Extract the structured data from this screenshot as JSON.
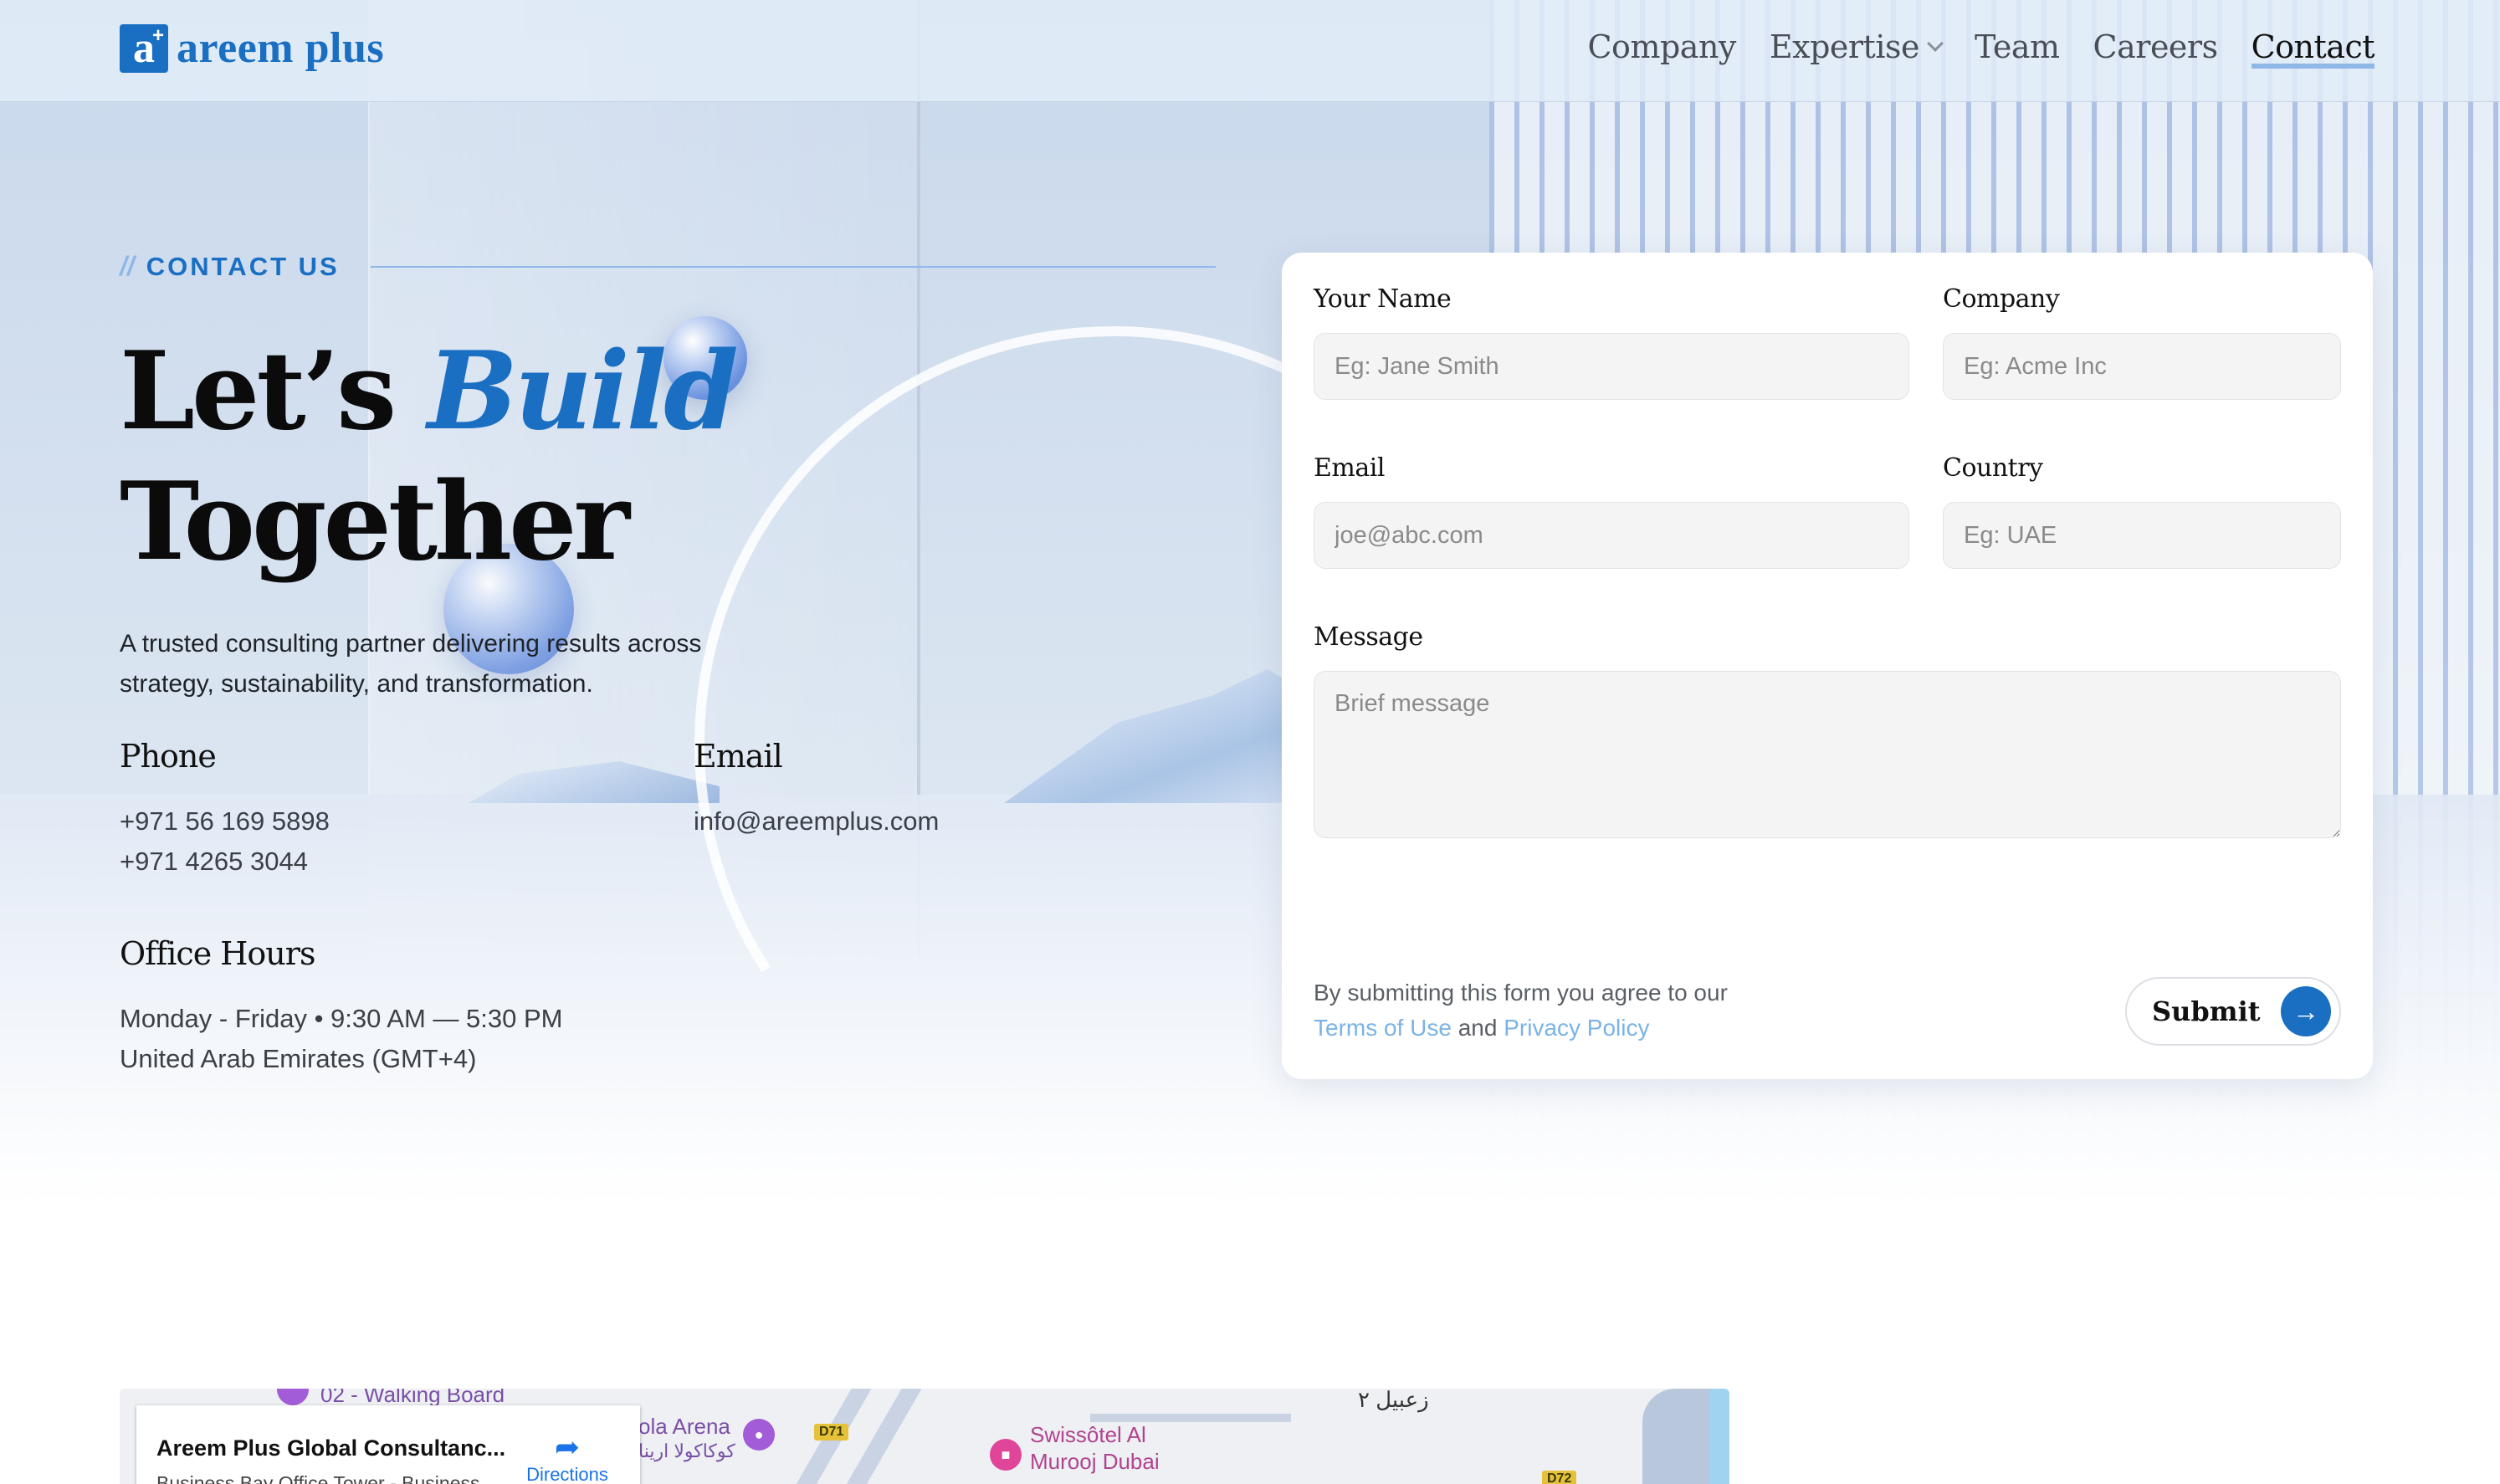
{
  "brand": {
    "mark": "a",
    "mark_plus": "+",
    "name": "areem plus"
  },
  "nav": {
    "items": [
      {
        "label": "Company"
      },
      {
        "label": "Expertise"
      },
      {
        "label": "Team"
      },
      {
        "label": "Careers"
      },
      {
        "label": "Contact"
      }
    ],
    "active": "Contact"
  },
  "hero": {
    "eyebrow_slash": "//",
    "eyebrow": "CONTACT US",
    "headline_part1": "Let’s ",
    "headline_accent": "Build",
    "headline_part2": "Together",
    "lead": "A trusted consulting partner delivering results across strategy, sustainability, and transformation."
  },
  "contact": {
    "phone_label": "Phone",
    "phones": [
      "+971 56 169 5898",
      "+971 4265 3044"
    ],
    "email_label": "Email",
    "email": "info@areemplus.com",
    "hours_label": "Office Hours",
    "hours_line1": "Monday - Friday • 9:30 AM — 5:30 PM",
    "hours_line2": "United Arab Emirates (GMT+4)"
  },
  "form": {
    "name_label": "Your Name",
    "name_placeholder": "Eg: Jane Smith",
    "company_label": "Company",
    "company_placeholder": "Eg: Acme Inc",
    "email_label": "Email",
    "email_placeholder": "joe@abc.com",
    "country_label": "Country",
    "country_placeholder": "Eg: UAE",
    "message_label": "Message",
    "message_placeholder": "Brief message",
    "agree_prefix": "By submitting this form you agree to our ",
    "terms": "Terms of Use",
    "agree_and": " and ",
    "privacy": "Privacy Policy",
    "submit": "Submit",
    "submit_icon": "arrow-right-icon",
    "accent_color": "#1a6fc2",
    "link_color": "#7ab3e6"
  },
  "map": {
    "place_title": "Areem Plus Global Consultanc...",
    "place_subtitle": "Business Bay Office Tower - Business",
    "directions": "Directions",
    "labels": {
      "walking": "02 - Walking Board",
      "arena": "ola Arena",
      "arena_ar": "كوكاكولا ارينا",
      "hotel1": "Swissôtel Al",
      "hotel2": "Murooj Dubai",
      "area_ar": "زعبيل ٢",
      "road1": "D71",
      "road2": "D72"
    }
  }
}
